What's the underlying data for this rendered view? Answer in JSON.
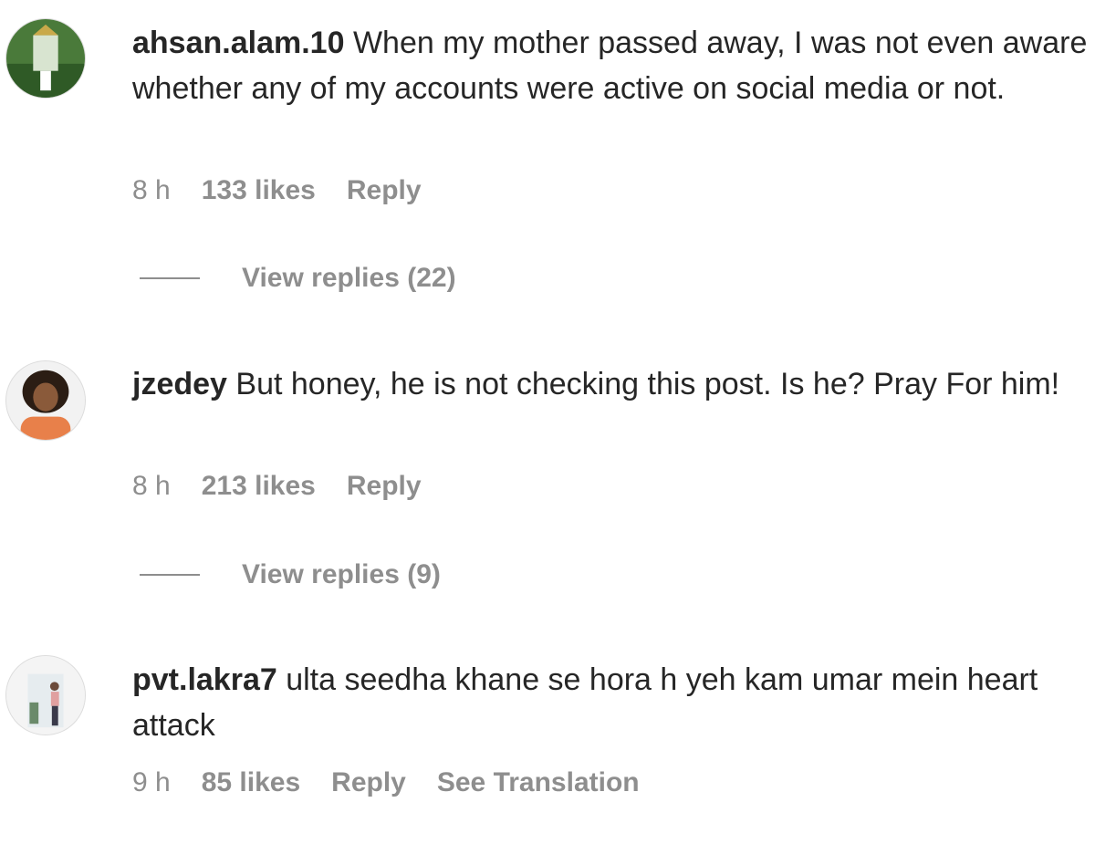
{
  "comments": [
    {
      "username": "ahsan.alam.10",
      "text": "When my mother passed away, I was not even aware whether any of my accounts were active on social media or not.",
      "time": "8 h",
      "likes": "133 likes",
      "reply_label": "Reply",
      "view_replies": "View replies (22)"
    },
    {
      "username": "jzedey",
      "text": "But honey, he is not checking this post. Is he? Pray For him!",
      "time": "8 h",
      "likes": "213 likes",
      "reply_label": "Reply",
      "view_replies": "View replies (9)"
    },
    {
      "username": "pvt.lakra7",
      "text": "ulta seedha khane se hora h yeh kam umar mein heart attack",
      "time": "9 h",
      "likes": "85 likes",
      "reply_label": "Reply",
      "translate_label": "See Translation"
    }
  ],
  "colors": {
    "text": "#262626",
    "secondary": "#8e8e8e",
    "background": "#ffffff"
  }
}
